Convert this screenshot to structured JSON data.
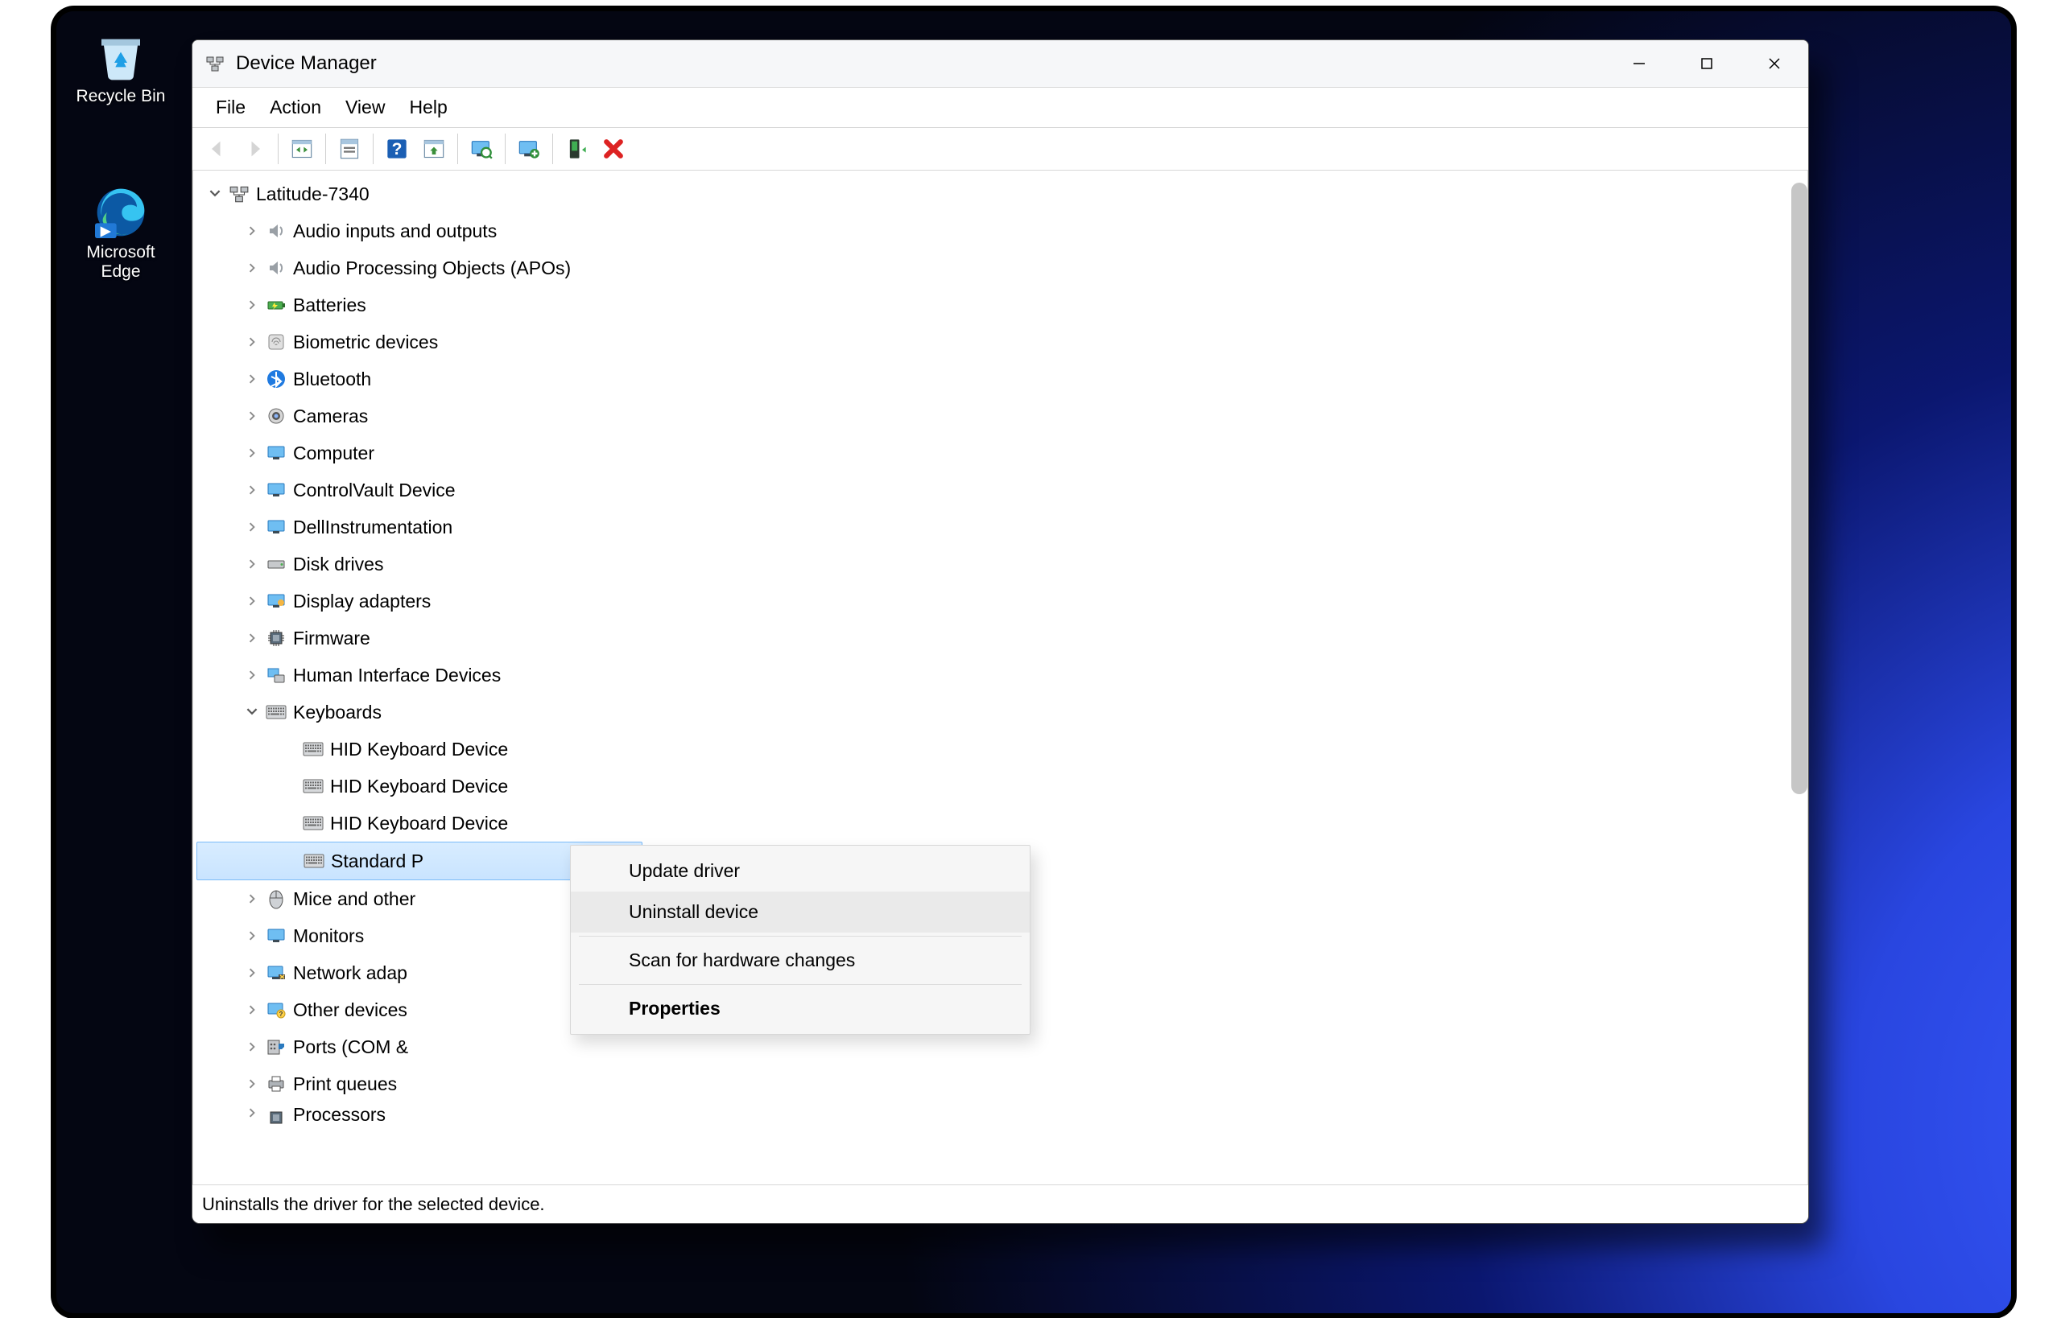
{
  "desktop": {
    "recycle_label": "Recycle Bin",
    "edge_label": "Microsoft Edge"
  },
  "window": {
    "title": "Device Manager"
  },
  "menubar": [
    "File",
    "Action",
    "View",
    "Help"
  ],
  "toolbar_icons": [
    "back-icon",
    "forward-icon",
    "|",
    "show-hide-tree-icon",
    "|",
    "properties-icon",
    "|",
    "help-icon",
    "update-driver-icon",
    "|",
    "scan-hardware-icon",
    "|",
    "add-legacy-icon",
    "|",
    "enable-icon",
    "uninstall-icon"
  ],
  "tree": {
    "root": "Latitude-7340",
    "categories": [
      {
        "label": "Audio inputs and outputs",
        "icon": "speaker",
        "expandable": true
      },
      {
        "label": "Audio Processing Objects (APOs)",
        "icon": "speaker",
        "expandable": true
      },
      {
        "label": "Batteries",
        "icon": "battery",
        "expandable": true
      },
      {
        "label": "Biometric devices",
        "icon": "fingerprint",
        "expandable": true
      },
      {
        "label": "Bluetooth",
        "icon": "bluetooth",
        "expandable": true
      },
      {
        "label": "Cameras",
        "icon": "camera",
        "expandable": true
      },
      {
        "label": "Computer",
        "icon": "monitor",
        "expandable": true
      },
      {
        "label": "ControlVault Device",
        "icon": "monitor",
        "expandable": true
      },
      {
        "label": "DellInstrumentation",
        "icon": "monitor",
        "expandable": true
      },
      {
        "label": "Disk drives",
        "icon": "disk",
        "expandable": true
      },
      {
        "label": "Display adapters",
        "icon": "display",
        "expandable": true
      },
      {
        "label": "Firmware",
        "icon": "chip",
        "expandable": true
      },
      {
        "label": "Human Interface Devices",
        "icon": "hid",
        "expandable": true
      },
      {
        "label": "Keyboards",
        "icon": "keyboard",
        "expanded": true,
        "children": [
          {
            "label": "HID Keyboard Device",
            "icon": "keyboard"
          },
          {
            "label": "HID Keyboard Device",
            "icon": "keyboard"
          },
          {
            "label": "HID Keyboard Device",
            "icon": "keyboard"
          },
          {
            "label": "Standard P",
            "icon": "keyboard",
            "selected": true
          }
        ]
      },
      {
        "label": "Mice and other",
        "icon": "mouse",
        "expandable": true,
        "truncated": true
      },
      {
        "label": "Monitors",
        "icon": "monitor",
        "expandable": true
      },
      {
        "label": "Network adap",
        "icon": "network",
        "expandable": true,
        "truncated": true
      },
      {
        "label": "Other devices",
        "icon": "other",
        "expandable": true
      },
      {
        "label": "Ports (COM &",
        "icon": "ports",
        "expandable": true,
        "truncated": true
      },
      {
        "label": "Print queues",
        "icon": "printer",
        "expandable": true
      },
      {
        "label": "Processors",
        "icon": "cpu",
        "expandable": true,
        "cut": true
      }
    ]
  },
  "context_menu": {
    "items": [
      {
        "label": "Update driver"
      },
      {
        "label": "Uninstall device",
        "highlighted": true
      },
      "---",
      {
        "label": "Scan for hardware changes"
      },
      "---",
      {
        "label": "Properties",
        "bold": true
      }
    ]
  },
  "statusbar": "Uninstalls the driver for the selected device."
}
